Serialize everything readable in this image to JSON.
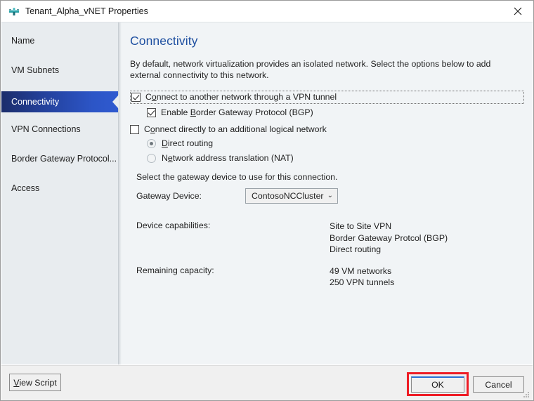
{
  "window": {
    "title": "Tenant_Alpha_vNET Properties",
    "icon": "network-subnet-icon",
    "close_label": "✕"
  },
  "sidebar": {
    "items": [
      {
        "label": "Name",
        "selected": false
      },
      {
        "label": "VM Subnets",
        "selected": false
      },
      {
        "label": "Connectivity",
        "selected": true
      },
      {
        "label": "VPN Connections",
        "selected": false
      },
      {
        "label": "Border Gateway Protocol...",
        "selected": false
      },
      {
        "label": "Access",
        "selected": false
      }
    ]
  },
  "main": {
    "heading": "Connectivity",
    "intro": "By default, network virtualization provides an isolated network. Select the options below to add external connectivity to this network.",
    "vpn_tunnel_checkbox": {
      "label_pre": "C",
      "label_acc": "o",
      "label_post": "nnect to another network through a VPN tunnel",
      "checked": true,
      "focused": true
    },
    "bgp_checkbox": {
      "label_pre": "Enable ",
      "label_acc": "B",
      "label_post": "order Gateway Protocol (BGP)",
      "checked": true
    },
    "logical_network_checkbox": {
      "label_pre": "C",
      "label_acc": "o",
      "label_post": "nnect directly to an additional logical network",
      "checked": false
    },
    "radios": [
      {
        "pre": "",
        "acc": "D",
        "post": "irect routing",
        "selected": true
      },
      {
        "pre": "N",
        "acc": "e",
        "post": "twork address translation (NAT)",
        "selected": false
      }
    ],
    "gateway_prompt": "Select the gateway device to use for this connection.",
    "gateway_label_acc": "G",
    "gateway_label_post": "ateway Device:",
    "gateway_device": {
      "value": "ContosoNCCluster",
      "chevron": "⌄"
    },
    "info": [
      {
        "key": "Device capabilities:",
        "values": [
          "Site to Site VPN",
          "Border Gateway Protcol (BGP)",
          "Direct routing"
        ]
      },
      {
        "key": "Remaining capacity:",
        "values": [
          "49 VM networks",
          "250 VPN tunnels"
        ]
      }
    ]
  },
  "footer": {
    "view_script": {
      "acc": "V",
      "post": "iew Script"
    },
    "ok": "OK",
    "cancel": "Cancel"
  },
  "colors": {
    "accent_blue": "#1e4fa0",
    "selected_nav_start": "#1b2d6b",
    "selected_nav_end": "#2f5ad0",
    "sidebar_bg": "#e8ecef",
    "main_bg": "#f1f4f6",
    "footer_bg": "#f0f0f0",
    "highlight_red": "#ee1c25",
    "default_button_accent": "#2a6fd4",
    "icon_teal": "#2aa2a8"
  }
}
